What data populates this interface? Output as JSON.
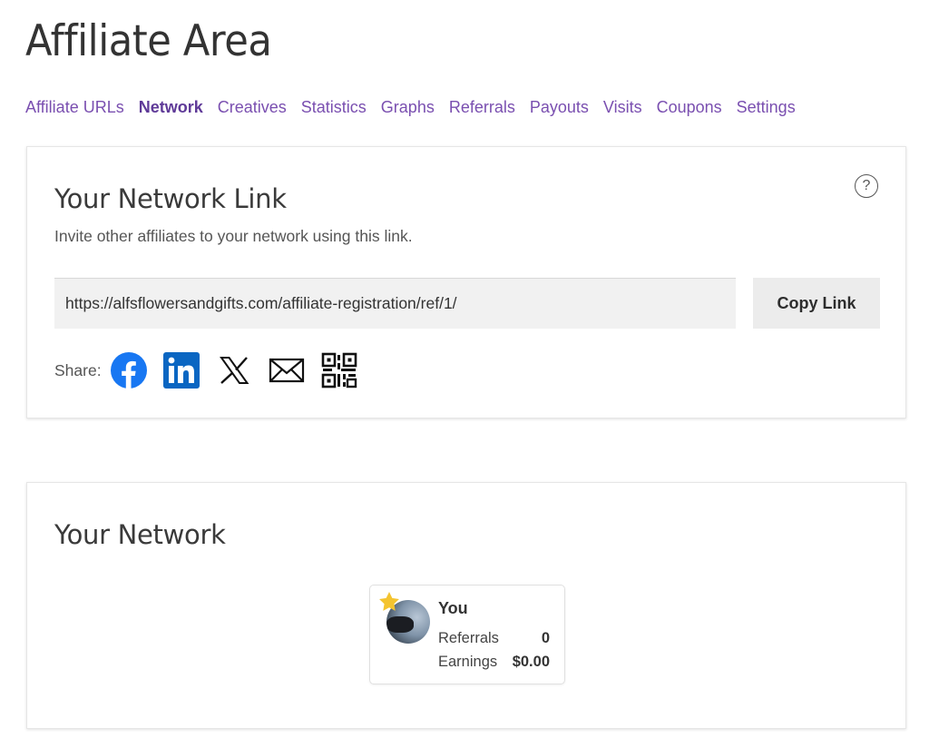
{
  "page": {
    "title": "Affiliate Area"
  },
  "tabs": [
    {
      "label": "Affiliate URLs",
      "active": false
    },
    {
      "label": "Network",
      "active": true
    },
    {
      "label": "Creatives",
      "active": false
    },
    {
      "label": "Statistics",
      "active": false
    },
    {
      "label": "Graphs",
      "active": false
    },
    {
      "label": "Referrals",
      "active": false
    },
    {
      "label": "Payouts",
      "active": false
    },
    {
      "label": "Visits",
      "active": false
    },
    {
      "label": "Coupons",
      "active": false
    },
    {
      "label": "Settings",
      "active": false
    }
  ],
  "network_link": {
    "title": "Your Network Link",
    "help_icon": "question-circle-icon",
    "subtitle": "Invite other affiliates to your network using this link.",
    "url": "https://alfsflowersandgifts.com/affiliate-registration/ref/1/",
    "copy_label": "Copy Link",
    "share_label": "Share:",
    "share_icons": [
      "facebook-icon",
      "linkedin-icon",
      "x-icon",
      "email-icon",
      "qr-code-icon"
    ]
  },
  "network": {
    "title": "Your Network",
    "member": {
      "name": "You",
      "referrals_label": "Referrals",
      "referrals_value": "0",
      "earnings_label": "Earnings",
      "earnings_value": "$0.00"
    }
  },
  "colors": {
    "tab_link": "#7a4fb0",
    "facebook": "#1877f2",
    "linkedin": "#0a66c2",
    "star": "#f4c430"
  }
}
